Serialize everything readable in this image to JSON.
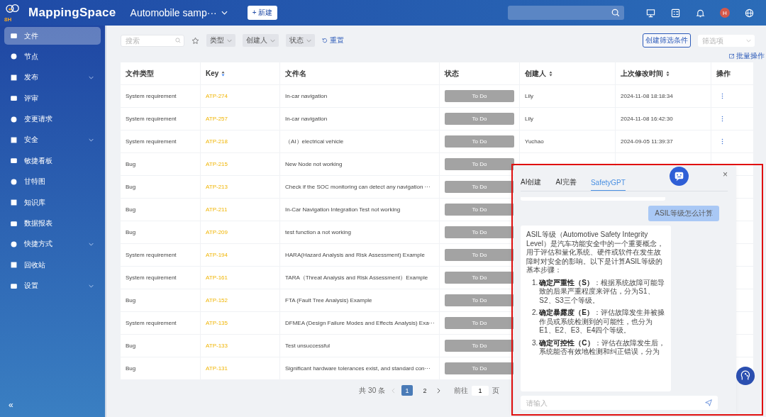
{
  "header": {
    "brand": "MappingSpace",
    "logo_mark": "8H",
    "project": "Automobile samp···",
    "new_button": "+ 新建",
    "avatar": "H"
  },
  "sidebar": {
    "items": [
      {
        "label": "文件",
        "selected": true,
        "expandable": false
      },
      {
        "label": "节点",
        "selected": false,
        "expandable": false
      },
      {
        "label": "发布",
        "selected": false,
        "expandable": true
      },
      {
        "label": "评审",
        "selected": false,
        "expandable": false
      },
      {
        "label": "变更请求",
        "selected": false,
        "expandable": false
      },
      {
        "label": "安全",
        "selected": false,
        "expandable": true
      },
      {
        "label": "敏捷看板",
        "selected": false,
        "expandable": false
      },
      {
        "label": "甘特图",
        "selected": false,
        "expandable": false
      },
      {
        "label": "知识库",
        "selected": false,
        "expandable": false
      },
      {
        "label": "数据报表",
        "selected": false,
        "expandable": false
      },
      {
        "label": "快捷方式",
        "selected": false,
        "expandable": true
      },
      {
        "label": "回收站",
        "selected": false,
        "expandable": false
      },
      {
        "label": "设置",
        "selected": false,
        "expandable": true
      }
    ],
    "collapse": "«"
  },
  "toolbar": {
    "search": {
      "placeholder": "搜索"
    },
    "filters": [
      "类型",
      "创建人",
      "状态"
    ],
    "reset": "重置",
    "create_filter": "创建筛选条件",
    "filter_select": {
      "placeholder": "筛选项"
    },
    "batch": "批量操作"
  },
  "table": {
    "columns": [
      {
        "label": "文件类型",
        "sortable": false
      },
      {
        "label": "Key",
        "sortable": true
      },
      {
        "label": "文件名",
        "sortable": false
      },
      {
        "label": "状态",
        "sortable": false
      },
      {
        "label": "创建人",
        "sortable": true
      },
      {
        "label": "上次修改时间",
        "sortable": true
      },
      {
        "label": "操作",
        "sortable": false
      }
    ],
    "rows": [
      {
        "type": "System requirement",
        "key": "ATP-274",
        "name": "In-car navigation",
        "status": "To Do",
        "creator": "Lily",
        "time": "2024-11-08 18:18:34"
      },
      {
        "type": "System requirement",
        "key": "ATP-257",
        "name": "In-car navigation",
        "status": "To Do",
        "creator": "Lily",
        "time": "2024-11-08 16:42:30"
      },
      {
        "type": "System requirement",
        "key": "ATP-218",
        "name": "（AI）electrical vehicle",
        "status": "To Do",
        "creator": "Yuchao",
        "time": "2024-09-05 11:39:37"
      },
      {
        "type": "Bug",
        "key": "ATP-215",
        "name": "New Node not working",
        "status": "To Do"
      },
      {
        "type": "Bug",
        "key": "ATP-213",
        "name": "Check if the SOC monitoring can detect any navigation ···",
        "status": "To Do"
      },
      {
        "type": "Bug",
        "key": "ATP-211",
        "name": "In-Car Navigation Integration Test not working",
        "status": "To Do"
      },
      {
        "type": "Bug",
        "key": "ATP-209",
        "name": "test function a not working",
        "status": "To Do"
      },
      {
        "type": "System requirement",
        "key": "ATP-194",
        "name": "HARA(Hazard Analysis and Risk Assessment) Example",
        "status": "To Do"
      },
      {
        "type": "System requirement",
        "key": "ATP-161",
        "name": "TARA（Threat Analysis and Risk Assessment）Example",
        "status": "To Do"
      },
      {
        "type": "Bug",
        "key": "ATP-152",
        "name": "FTA (Fault Tree Analysis) Example",
        "status": "To Do"
      },
      {
        "type": "System requirement",
        "key": "ATP-135",
        "name": "DFMEA (Design Failure Modes and Effects Analysis) Exa···",
        "status": "To Do"
      },
      {
        "type": "Bug",
        "key": "ATP-133",
        "name": "Test unsuccessful",
        "status": "To Do"
      },
      {
        "type": "Bug",
        "key": "ATP-131",
        "name": "Significant hardware tolerances exist, and standard con···",
        "status": "To Do"
      }
    ]
  },
  "pagination": {
    "total": "共 30 条",
    "pages": [
      {
        "label": "1",
        "selected": true
      },
      {
        "label": "2",
        "selected": false
      }
    ],
    "goto": "前往",
    "goto_value": "1",
    "page_unit": "页"
  },
  "chat_panel": {
    "tabs": [
      {
        "label": "AI创建",
        "selected": false
      },
      {
        "label": "AI完善",
        "selected": false
      },
      {
        "label": "SafetyGPT",
        "selected": true
      }
    ],
    "close": "×",
    "user_message": "ASIL等级怎么计算",
    "answer_intro": "ASIL等级（Automotive Safety Integrity Level）是汽车功能安全中的一个重要概念，用于评估和量化系统、硬件或软件在发生故障时对安全的影响。以下是计算ASIL等级的基本步骤：",
    "answer_steps": [
      {
        "number": "1.",
        "text": "**确定严重性（S）**：根据系统故障可能导致的后果严重程度来评估，分为S1、S2、S3三个等级。"
      },
      {
        "number": "2.",
        "text": "**确定暴露度（E）**：评估故障发生并被操作员或系统检测到的可能性，也分为E1、E2、E3、E4四个等级。"
      },
      {
        "number": "3.",
        "text": "**确定可控性（C）**：评估在故障发生后，系统能否有效地检测和纠正错误，分为"
      }
    ],
    "input": {
      "placeholder": "请输入"
    }
  }
}
